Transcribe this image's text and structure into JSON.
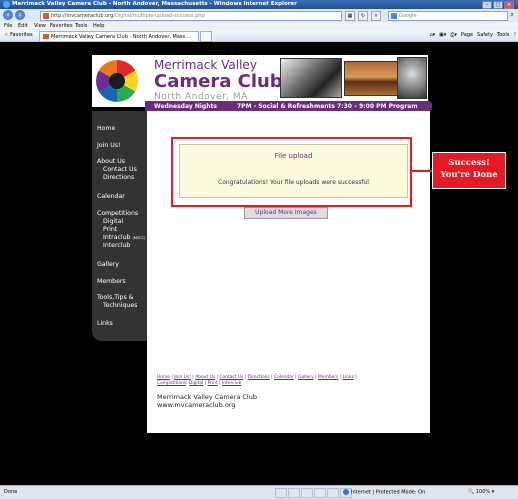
{
  "window": {
    "title": "Merrimack Valley Camera Club - North Andover, Massachusetts - Windows Internet Explorer"
  },
  "address": {
    "url": "http://mvcameraclub.org",
    "url_rest": "/Digital/multiple-upload-success.php"
  },
  "search": {
    "placeholder": "Google"
  },
  "menu": [
    "File",
    "Edit",
    "View",
    "Favorites",
    "Tools",
    "Help"
  ],
  "favorites": {
    "label": "Favorites"
  },
  "tab": {
    "title": "Merrimack Valley Camera Club - North Andover, Mass..."
  },
  "commandbar": {
    "page": "Page",
    "safety": "Safety",
    "tools": "Tools"
  },
  "site": {
    "name1": "Merrimack Valley",
    "name2": "Camera Club",
    "location": "North Andover, MA",
    "banner": {
      "day": "Wednesday Nights",
      "social": "7PM - Social & Refreshments",
      "program": "7:30 – 9:00 PM Program"
    }
  },
  "nav": {
    "home": "Home",
    "join": "Join Us!",
    "about": "About Us",
    "contact": "Contact Us",
    "directions": "Directions",
    "calendar": "Calendar",
    "competitions": "Competitions",
    "digital": "Digital",
    "print": "Print",
    "intraclub": "Intraclub",
    "intraclub_sub": "(MVCC)",
    "interclub": "Interclub",
    "gallery": "Gallery",
    "members": "Members",
    "tools1": "Tools,Tips &",
    "tools2": "Techniques",
    "links": "Links"
  },
  "upload": {
    "title": "File upload",
    "message": "Congratulations! Your file uploads were successful",
    "more_button": "Upload More Images"
  },
  "callout": {
    "line1": "Success!",
    "line2": "You're Done"
  },
  "footer": {
    "links1": [
      "Home",
      "Join Us!",
      "About Us",
      "Contact Us",
      "Directions",
      "Calendar",
      "Gallery",
      "Members",
      "Links"
    ],
    "links2": [
      "Competitions",
      "Digital",
      "Print",
      "Interclub"
    ],
    "name": "Merrimack Valley Camera Club",
    "site": "www.mvcameraclub.org"
  },
  "status": {
    "left": "Done",
    "zone": "Internet | Protected Mode: On",
    "zoom": "100%"
  }
}
